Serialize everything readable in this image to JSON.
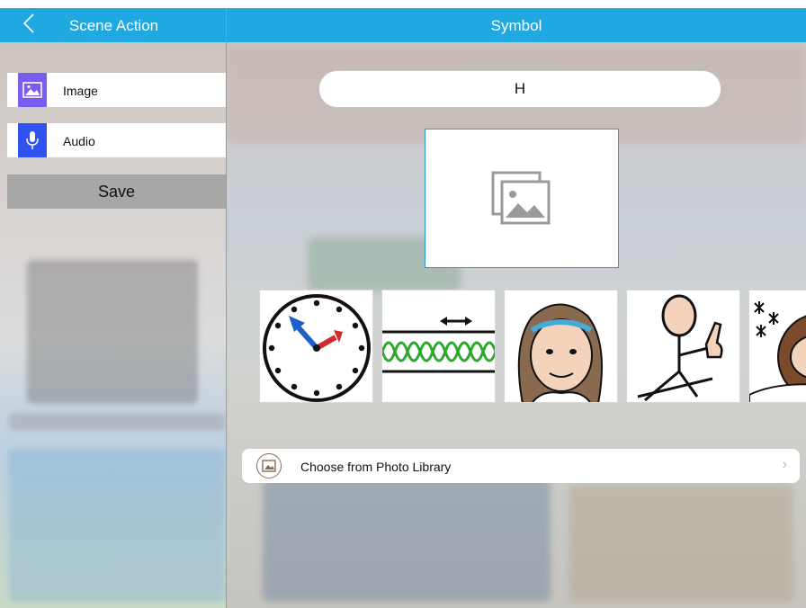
{
  "left_panel": {
    "title": "Scene Action",
    "back_icon": "chevron-left-icon",
    "actions": [
      {
        "label": "Image",
        "icon": "image-icon",
        "color": "#7a5cf0"
      },
      {
        "label": "Audio",
        "icon": "microphone-icon",
        "color": "#2f52f0"
      }
    ],
    "save_label": "Save"
  },
  "right_panel": {
    "title": "Symbol",
    "name_value": "H",
    "preview_icon": "image-placeholder-icon",
    "symbols": [
      {
        "icon": "clock-symbol"
      },
      {
        "icon": "wave-frequency-symbol"
      },
      {
        "icon": "girl-face-symbol"
      },
      {
        "icon": "person-pointing-symbol"
      },
      {
        "icon": "winter-person-symbol"
      }
    ],
    "photo_library": {
      "label": "Choose from Photo Library",
      "icon": "photo-library-icon",
      "chevron": "›"
    }
  },
  "colors": {
    "header": "#20a8e0",
    "save_button": "#a7a7a7",
    "preview_border": "#2e9ad8"
  }
}
